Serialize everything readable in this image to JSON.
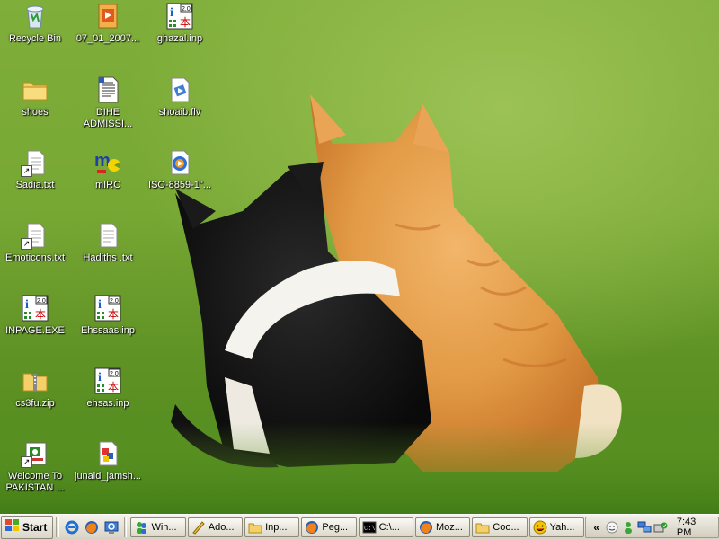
{
  "desktop": {
    "icons": [
      {
        "label": "Recycle Bin"
      },
      {
        "label": "07_01_2007..."
      },
      {
        "label": "ghazal.inp"
      },
      {
        "label": "shoes"
      },
      {
        "label": "DIHE\nADMISSI..."
      },
      {
        "label": "shoaib.flv"
      },
      {
        "label": "Sadia.txt"
      },
      {
        "label": "mIRC"
      },
      {
        "label": "ISO-8859-1\"..."
      },
      {
        "label": "Emoticons.txt"
      },
      {
        "label": "Hadiths .txt"
      },
      {
        "label": "INPAGE.EXE"
      },
      {
        "label": "Ehssaas.inp"
      },
      {
        "label": "cs3fu.zip"
      },
      {
        "label": "ehsas.inp"
      },
      {
        "label": "Welcome To\nPAKISTAN ..."
      },
      {
        "label": "junaid_jamsh..."
      }
    ]
  },
  "taskbar": {
    "start_label": "Start",
    "quick_launch": [
      "ie-icon",
      "firefox-icon",
      "desktop-icon"
    ],
    "tasks": [
      {
        "label": "Win...",
        "icon": "msn-icon"
      },
      {
        "label": "Ado...",
        "icon": "adobe-icon"
      },
      {
        "label": "Inp...",
        "icon": "folder-icon"
      },
      {
        "label": "Peg...",
        "icon": "firefox-icon"
      },
      {
        "label": "C:\\...",
        "icon": "cmd-icon"
      },
      {
        "label": "Moz...",
        "icon": "firefox-icon"
      },
      {
        "label": "Coo...",
        "icon": "folder-icon"
      },
      {
        "label": "Yah...",
        "icon": "yahoo-icon"
      }
    ],
    "tray": {
      "expand_label": "«",
      "clock": "7:43 PM"
    }
  },
  "colors": {
    "wallpaper_grass": "#78a834",
    "taskbar": "#d7d3c4",
    "icon_text": "#ffffff"
  }
}
